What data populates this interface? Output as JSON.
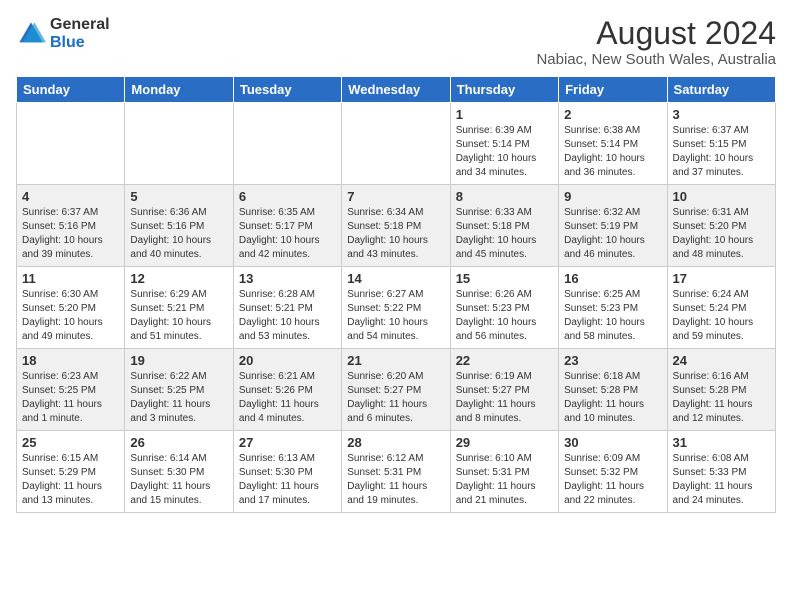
{
  "header": {
    "logo_general": "General",
    "logo_blue": "Blue",
    "title": "August 2024",
    "subtitle": "Nabiac, New South Wales, Australia"
  },
  "weekdays": [
    "Sunday",
    "Monday",
    "Tuesday",
    "Wednesday",
    "Thursday",
    "Friday",
    "Saturday"
  ],
  "weeks": [
    [
      {
        "day": "",
        "info": ""
      },
      {
        "day": "",
        "info": ""
      },
      {
        "day": "",
        "info": ""
      },
      {
        "day": "",
        "info": ""
      },
      {
        "day": "1",
        "info": "Sunrise: 6:39 AM\nSunset: 5:14 PM\nDaylight: 10 hours\nand 34 minutes."
      },
      {
        "day": "2",
        "info": "Sunrise: 6:38 AM\nSunset: 5:14 PM\nDaylight: 10 hours\nand 36 minutes."
      },
      {
        "day": "3",
        "info": "Sunrise: 6:37 AM\nSunset: 5:15 PM\nDaylight: 10 hours\nand 37 minutes."
      }
    ],
    [
      {
        "day": "4",
        "info": "Sunrise: 6:37 AM\nSunset: 5:16 PM\nDaylight: 10 hours\nand 39 minutes."
      },
      {
        "day": "5",
        "info": "Sunrise: 6:36 AM\nSunset: 5:16 PM\nDaylight: 10 hours\nand 40 minutes."
      },
      {
        "day": "6",
        "info": "Sunrise: 6:35 AM\nSunset: 5:17 PM\nDaylight: 10 hours\nand 42 minutes."
      },
      {
        "day": "7",
        "info": "Sunrise: 6:34 AM\nSunset: 5:18 PM\nDaylight: 10 hours\nand 43 minutes."
      },
      {
        "day": "8",
        "info": "Sunrise: 6:33 AM\nSunset: 5:18 PM\nDaylight: 10 hours\nand 45 minutes."
      },
      {
        "day": "9",
        "info": "Sunrise: 6:32 AM\nSunset: 5:19 PM\nDaylight: 10 hours\nand 46 minutes."
      },
      {
        "day": "10",
        "info": "Sunrise: 6:31 AM\nSunset: 5:20 PM\nDaylight: 10 hours\nand 48 minutes."
      }
    ],
    [
      {
        "day": "11",
        "info": "Sunrise: 6:30 AM\nSunset: 5:20 PM\nDaylight: 10 hours\nand 49 minutes."
      },
      {
        "day": "12",
        "info": "Sunrise: 6:29 AM\nSunset: 5:21 PM\nDaylight: 10 hours\nand 51 minutes."
      },
      {
        "day": "13",
        "info": "Sunrise: 6:28 AM\nSunset: 5:21 PM\nDaylight: 10 hours\nand 53 minutes."
      },
      {
        "day": "14",
        "info": "Sunrise: 6:27 AM\nSunset: 5:22 PM\nDaylight: 10 hours\nand 54 minutes."
      },
      {
        "day": "15",
        "info": "Sunrise: 6:26 AM\nSunset: 5:23 PM\nDaylight: 10 hours\nand 56 minutes."
      },
      {
        "day": "16",
        "info": "Sunrise: 6:25 AM\nSunset: 5:23 PM\nDaylight: 10 hours\nand 58 minutes."
      },
      {
        "day": "17",
        "info": "Sunrise: 6:24 AM\nSunset: 5:24 PM\nDaylight: 10 hours\nand 59 minutes."
      }
    ],
    [
      {
        "day": "18",
        "info": "Sunrise: 6:23 AM\nSunset: 5:25 PM\nDaylight: 11 hours\nand 1 minute."
      },
      {
        "day": "19",
        "info": "Sunrise: 6:22 AM\nSunset: 5:25 PM\nDaylight: 11 hours\nand 3 minutes."
      },
      {
        "day": "20",
        "info": "Sunrise: 6:21 AM\nSunset: 5:26 PM\nDaylight: 11 hours\nand 4 minutes."
      },
      {
        "day": "21",
        "info": "Sunrise: 6:20 AM\nSunset: 5:27 PM\nDaylight: 11 hours\nand 6 minutes."
      },
      {
        "day": "22",
        "info": "Sunrise: 6:19 AM\nSunset: 5:27 PM\nDaylight: 11 hours\nand 8 minutes."
      },
      {
        "day": "23",
        "info": "Sunrise: 6:18 AM\nSunset: 5:28 PM\nDaylight: 11 hours\nand 10 minutes."
      },
      {
        "day": "24",
        "info": "Sunrise: 6:16 AM\nSunset: 5:28 PM\nDaylight: 11 hours\nand 12 minutes."
      }
    ],
    [
      {
        "day": "25",
        "info": "Sunrise: 6:15 AM\nSunset: 5:29 PM\nDaylight: 11 hours\nand 13 minutes."
      },
      {
        "day": "26",
        "info": "Sunrise: 6:14 AM\nSunset: 5:30 PM\nDaylight: 11 hours\nand 15 minutes."
      },
      {
        "day": "27",
        "info": "Sunrise: 6:13 AM\nSunset: 5:30 PM\nDaylight: 11 hours\nand 17 minutes."
      },
      {
        "day": "28",
        "info": "Sunrise: 6:12 AM\nSunset: 5:31 PM\nDaylight: 11 hours\nand 19 minutes."
      },
      {
        "day": "29",
        "info": "Sunrise: 6:10 AM\nSunset: 5:31 PM\nDaylight: 11 hours\nand 21 minutes."
      },
      {
        "day": "30",
        "info": "Sunrise: 6:09 AM\nSunset: 5:32 PM\nDaylight: 11 hours\nand 22 minutes."
      },
      {
        "day": "31",
        "info": "Sunrise: 6:08 AM\nSunset: 5:33 PM\nDaylight: 11 hours\nand 24 minutes."
      }
    ]
  ]
}
